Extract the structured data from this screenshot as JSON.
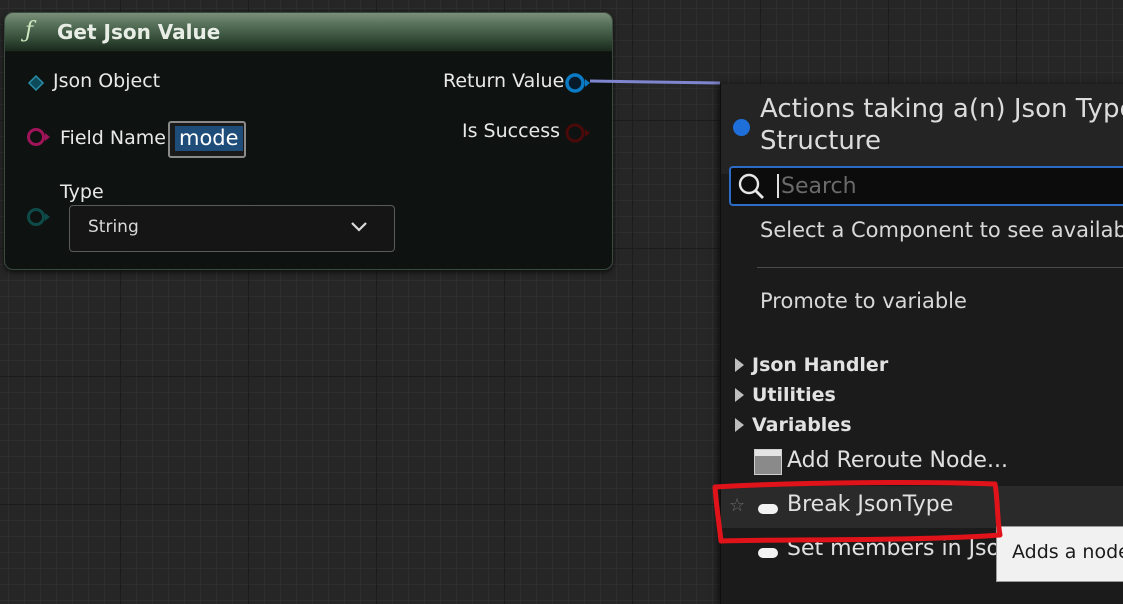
{
  "node": {
    "icon": "function-icon",
    "title": "Get Json Value",
    "pins": {
      "json_object": "Json Object",
      "field_name": "Field Name",
      "field_name_value": "mode",
      "type": "Type",
      "type_value": "String",
      "return_value": "Return Value",
      "is_success": "Is Success"
    }
  },
  "menu": {
    "title_line1": "Actions taking a(n) Json Type",
    "title_line2": "Structure",
    "search_placeholder": "Search",
    "component_hint": "Select a Component to see availabl",
    "promote": "Promote to variable",
    "categories": [
      "Json Handler",
      "Utilities",
      "Variables"
    ],
    "items": [
      {
        "label": "Add Reroute Node...",
        "icon": "reroute-node-icon"
      },
      {
        "label": "Break JsonType",
        "icon": "struct-pill-icon"
      },
      {
        "label": "Set members in Jso",
        "icon": "struct-pill-icon"
      }
    ]
  },
  "tooltip": "Adds a node",
  "colors": {
    "accent_blue": "#1e6fd9",
    "annotation_red": "#e0121a",
    "node_header_green": "#56705a",
    "exec_pin_pink": "#d2176d",
    "json_pin_blue": "#0b7ac4",
    "wire_blue": "#7f86cf"
  }
}
